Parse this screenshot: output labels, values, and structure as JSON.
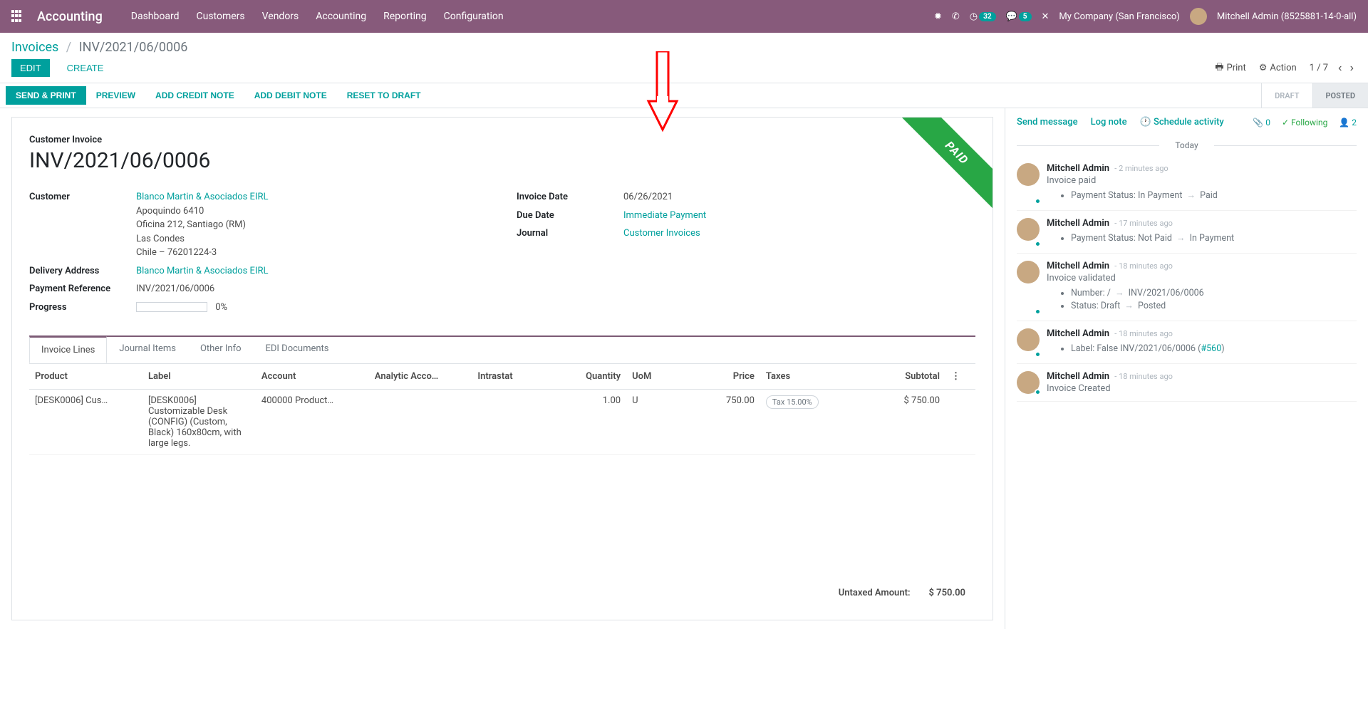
{
  "navbar": {
    "brand": "Accounting",
    "menu": [
      "Dashboard",
      "Customers",
      "Vendors",
      "Accounting",
      "Reporting",
      "Configuration"
    ],
    "clock_badge": "32",
    "chat_badge": "5",
    "company": "My Company (San Francisco)",
    "user": "Mitchell Admin (8525881-14-0-all)"
  },
  "breadcrumb": {
    "parent": "Invoices",
    "current": "INV/2021/06/0006"
  },
  "cp": {
    "edit": "EDIT",
    "create": "CREATE",
    "print": "Print",
    "action": "Action",
    "pager": "1 / 7"
  },
  "statusbar": {
    "send_print": "SEND & PRINT",
    "preview": "PREVIEW",
    "credit": "ADD CREDIT NOTE",
    "debit": "ADD DEBIT NOTE",
    "reset": "RESET TO DRAFT",
    "status_draft": "DRAFT",
    "status_posted": "POSTED"
  },
  "ribbon": "PAID",
  "form": {
    "type_label": "Customer Invoice",
    "name": "INV/2021/06/0006",
    "customer_label": "Customer",
    "customer_name": "Blanco Martin & Asociados EIRL",
    "customer_addr1": "Apoquindo 6410",
    "customer_addr2": "Oficina 212, Santiago (RM)",
    "customer_addr3": "Las Condes",
    "customer_addr4": "Chile – 76201224-3",
    "delivery_label": "Delivery Address",
    "delivery_value": "Blanco Martin & Asociados EIRL",
    "payref_label": "Payment Reference",
    "payref_value": "INV/2021/06/0006",
    "progress_label": "Progress",
    "progress_value": "0%",
    "invoice_date_label": "Invoice Date",
    "invoice_date": "06/26/2021",
    "due_date_label": "Due Date",
    "due_date": "Immediate Payment",
    "journal_label": "Journal",
    "journal": "Customer Invoices"
  },
  "tabs": [
    "Invoice Lines",
    "Journal Items",
    "Other Info",
    "EDI Documents"
  ],
  "table": {
    "headers": {
      "product": "Product",
      "label": "Label",
      "account": "Account",
      "analytic": "Analytic Acco…",
      "intrastat": "Intrastat",
      "quantity": "Quantity",
      "uom": "UoM",
      "price": "Price",
      "taxes": "Taxes",
      "subtotal": "Subtotal"
    },
    "row": {
      "product": "[DESK0006] Cus…",
      "label": "[DESK0006] Customizable Desk (CONFIG) (Custom, Black) 160x80cm, with large legs.",
      "account": "400000 Product…",
      "quantity": "1.00",
      "uom": "U",
      "price": "750.00",
      "tax": "Tax 15.00%",
      "subtotal": "$ 750.00"
    },
    "totals": {
      "untaxed_label": "Untaxed Amount:",
      "untaxed_value": "$ 750.00"
    }
  },
  "chatter": {
    "send": "Send message",
    "log": "Log note",
    "schedule": "Schedule activity",
    "attach_count": "0",
    "following": "Following",
    "followers": "2",
    "date_sep": "Today",
    "messages": [
      {
        "author": "Mitchell Admin",
        "time": "- 2 minutes ago",
        "note": "Invoice paid",
        "items": [
          {
            "label": "Payment Status:",
            "from": "In Payment",
            "to": "Paid"
          }
        ]
      },
      {
        "author": "Mitchell Admin",
        "time": "- 17 minutes ago",
        "items": [
          {
            "label": "Payment Status:",
            "from": "Not Paid",
            "to": "In Payment"
          }
        ]
      },
      {
        "author": "Mitchell Admin",
        "time": "- 18 minutes ago",
        "note": "Invoice validated",
        "items": [
          {
            "label": "Number:",
            "from": "/",
            "to": "INV/2021/06/0006"
          },
          {
            "label": "Status:",
            "from": "Draft",
            "to": "Posted"
          }
        ]
      },
      {
        "author": "Mitchell Admin",
        "time": "- 18 minutes ago",
        "items": [
          {
            "label": "Label:",
            "from": "False",
            "to_prefix": "INV/2021/06/0006 (",
            "to_link": "#560",
            "to_suffix": ")"
          }
        ]
      },
      {
        "author": "Mitchell Admin",
        "time": "- 18 minutes ago",
        "note": "Invoice Created"
      }
    ]
  }
}
